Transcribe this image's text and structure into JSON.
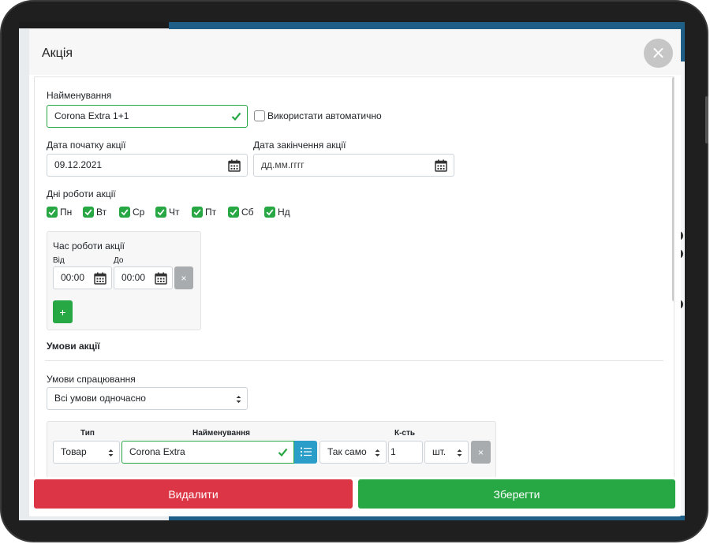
{
  "modal": {
    "title": "Акція",
    "close_icon": "×"
  },
  "form": {
    "name_label": "Найменування",
    "name_value": "Corona Extra 1+1",
    "auto_label": "Використати автоматично",
    "start_label": "Дата початку акції",
    "start_value": "09.12.2021",
    "end_label": "Дата закінчення акції",
    "end_placeholder": "дд.мм.гггг",
    "days_label": "Дні роботи акції",
    "days": [
      {
        "label": "Пн",
        "checked": true
      },
      {
        "label": "Вт",
        "checked": true
      },
      {
        "label": "Ср",
        "checked": true
      },
      {
        "label": "Чт",
        "checked": true
      },
      {
        "label": "Пт",
        "checked": true
      },
      {
        "label": "Сб",
        "checked": true
      },
      {
        "label": "Нд",
        "checked": true
      }
    ],
    "time": {
      "title": "Час роботи акції",
      "from_label": "Від",
      "to_label": "До",
      "from_value": "00:00",
      "to_value": "00:00",
      "remove_label": "×",
      "add_label": "+"
    },
    "conditions_title": "Умови акції",
    "trigger_label": "Умови спрацювання",
    "trigger_value": "Всі умови одночасно",
    "cond_table": {
      "col_type": "Тип",
      "col_name": "Найменування",
      "col_qty": "К-сть",
      "type_value": "Товар",
      "name_value": "Corona Extra",
      "same_value": "Так само",
      "qty_value": "1",
      "unit_value": "шт.",
      "remove_label": "×"
    }
  },
  "footer": {
    "delete_label": "Видалити",
    "save_label": "Зберегти"
  },
  "colors": {
    "success": "#28a745",
    "danger": "#dc3545",
    "info": "#2a9dc9",
    "secondary": "#a9acaf"
  }
}
